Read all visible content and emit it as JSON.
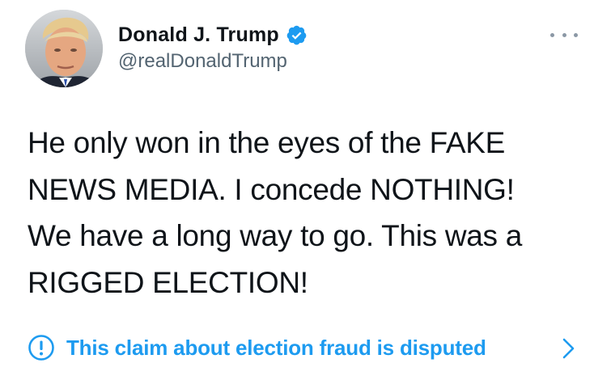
{
  "tweet": {
    "author": {
      "display_name": "Donald J. Trump",
      "handle": "@realDonaldTrump",
      "verified": true,
      "avatar_icon": "profile-photo"
    },
    "more_icon": "more-dots-icon",
    "text_lines": [
      "He only won in the eyes of the FAKE",
      "NEWS MEDIA. I concede NOTHING!",
      "We have a long way to go. This was a",
      "RIGGED ELECTION!"
    ],
    "notice": {
      "icon": "exclamation-circle-icon",
      "text": "This claim about election fraud is disputed",
      "chevron_icon": "chevron-right-icon"
    },
    "colors": {
      "accent": "#1d9bf0",
      "verified_badge": "#1d9bf0",
      "text": "#0f1419",
      "secondary_text": "#536471"
    }
  }
}
